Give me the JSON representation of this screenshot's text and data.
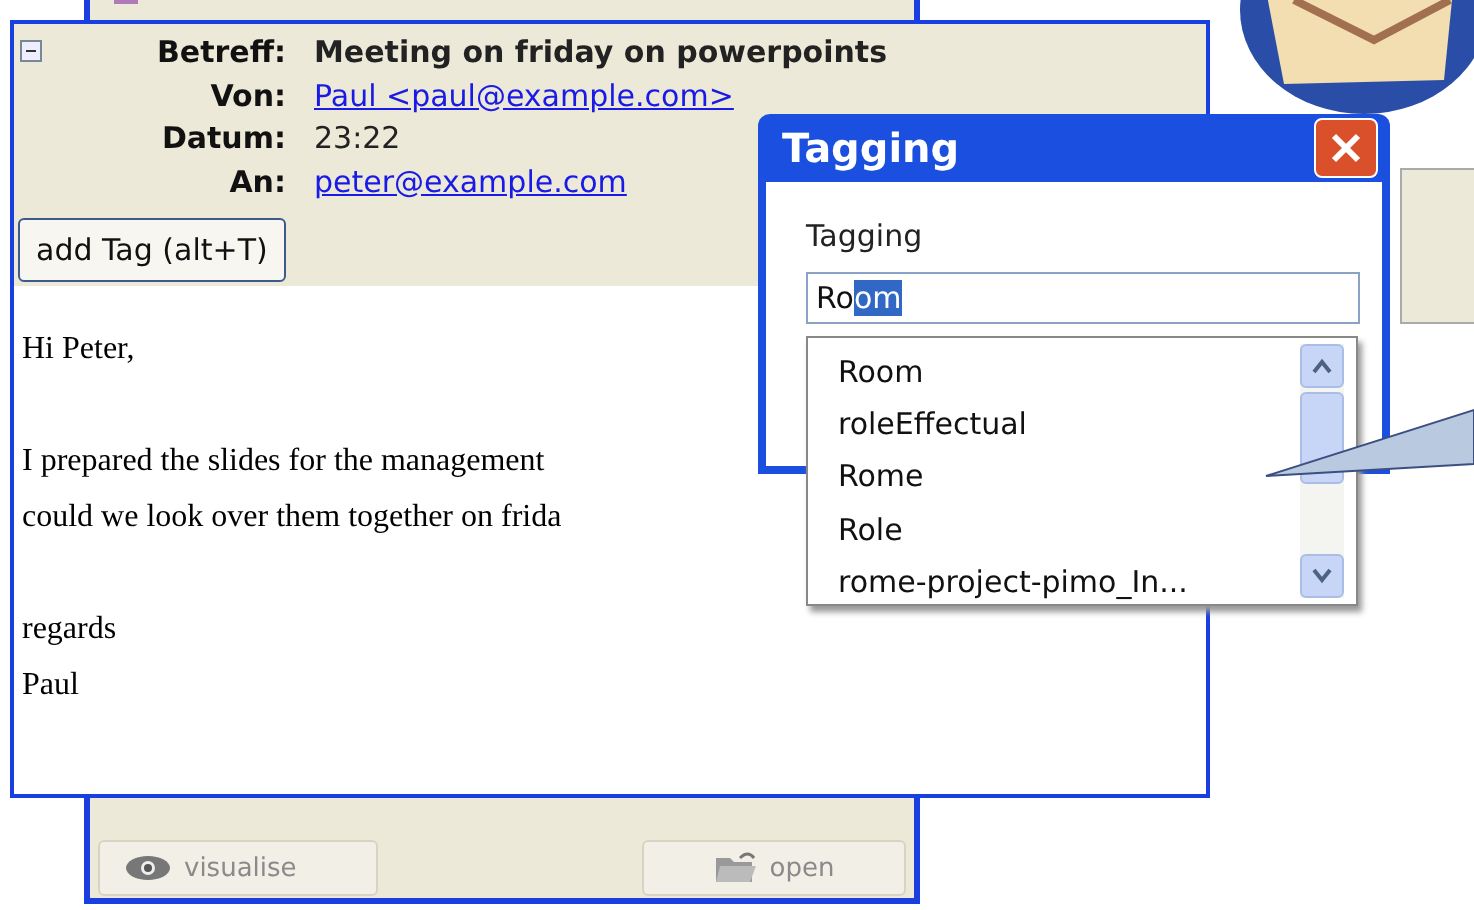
{
  "back_window": {
    "buttons": [
      {
        "label": "visualise",
        "disabled": true
      },
      {
        "label": "open",
        "disabled": true
      }
    ]
  },
  "mail": {
    "expanded": true,
    "headers": [
      {
        "label": "Betreff:",
        "value": "Meeting on friday on powerpoints",
        "kind": "subject"
      },
      {
        "label": "Von:",
        "value": "Paul <paul@example.com>",
        "kind": "link"
      },
      {
        "label": "Datum:",
        "value": "23:22",
        "kind": "plain"
      },
      {
        "label": "An:",
        "value": "peter@example.com",
        "kind": "link"
      }
    ],
    "add_tag_button": "add Tag (alt+T)",
    "body": [
      [
        "Hi Peter,"
      ],
      [
        "I prepared the slides for the management",
        "could we look over them together on frida"
      ],
      [
        "regards",
        "Paul"
      ]
    ]
  },
  "dialog": {
    "title": "Tagging",
    "label": "Tagging",
    "input": {
      "typed": "Ro",
      "autocompleted": "om"
    },
    "suggestions": [
      "Room",
      "roleEffectual",
      "Rome",
      "Role",
      "rome-project-pimo_In..."
    ]
  }
}
